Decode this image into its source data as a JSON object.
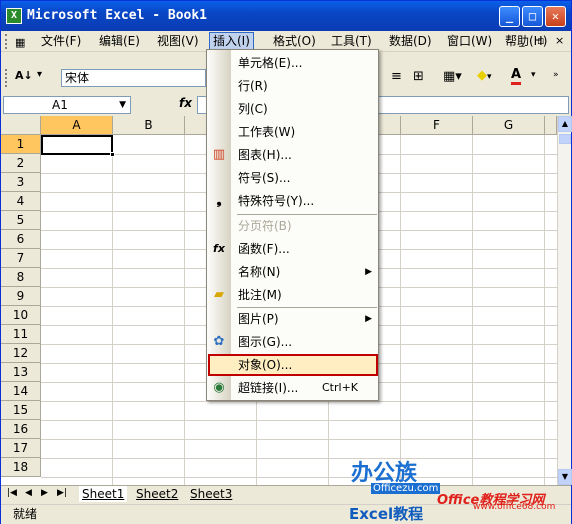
{
  "window": {
    "title": "Microsoft Excel - Book1"
  },
  "menubar": {
    "items": [
      "文件(F)",
      "编辑(E)",
      "视图(V)",
      "插入(I)",
      "格式(O)",
      "工具(T)",
      "数据(D)",
      "窗口(W)",
      "帮助(H)"
    ],
    "active": "插入(I)"
  },
  "toolbar": {
    "font": "宋体"
  },
  "formula": {
    "namebox": "A1",
    "fx": "fx",
    "content": ""
  },
  "columns": [
    "A",
    "B",
    "C",
    "D",
    "E",
    "F",
    "G"
  ],
  "rows": [
    "1",
    "2",
    "3",
    "4",
    "5",
    "6",
    "7",
    "8",
    "9",
    "10",
    "11",
    "12",
    "13",
    "14",
    "15",
    "16",
    "17",
    "18"
  ],
  "insert_menu": {
    "items": [
      {
        "label": "单元格(E)...",
        "enabled": true
      },
      {
        "label": "行(R)",
        "enabled": true
      },
      {
        "label": "列(C)",
        "enabled": true
      },
      {
        "label": "工作表(W)",
        "enabled": true
      },
      {
        "label": "图表(H)...",
        "enabled": true,
        "icon": "chart-icon"
      },
      {
        "label": "符号(S)...",
        "enabled": true
      },
      {
        "label": "特殊符号(Y)...",
        "enabled": true,
        "icon": "comma-icon"
      },
      {
        "label": "分页符(B)",
        "enabled": false
      },
      {
        "label": "函数(F)...",
        "enabled": true,
        "icon": "function-icon"
      },
      {
        "label": "名称(N)",
        "enabled": true,
        "submenu": true
      },
      {
        "label": "批注(M)",
        "enabled": true,
        "icon": "comment-icon"
      },
      {
        "label": "图片(P)",
        "enabled": true,
        "submenu": true
      },
      {
        "label": "图示(G)...",
        "enabled": true,
        "icon": "diagram-icon"
      },
      {
        "label": "对象(O)...",
        "enabled": true,
        "highlighted": true
      },
      {
        "label": "超链接(I)...",
        "shortcut": "Ctrl+K",
        "enabled": true,
        "icon": "hyperlink-icon"
      }
    ]
  },
  "sheets": {
    "tabs": [
      "Sheet1",
      "Sheet2",
      "Sheet3"
    ],
    "active": "Sheet1"
  },
  "status": {
    "text": "就绪"
  },
  "watermarks": {
    "logo_cn": "办公族",
    "logo_url": "Officezu.com",
    "site_name": "Office教程学习网",
    "site_url": "www.office68.com",
    "tutorial": "Excel教程"
  },
  "colors": {
    "accent": "#ffc660",
    "highlight_border": "#c00000",
    "title_blue": "#0a5fe8"
  }
}
